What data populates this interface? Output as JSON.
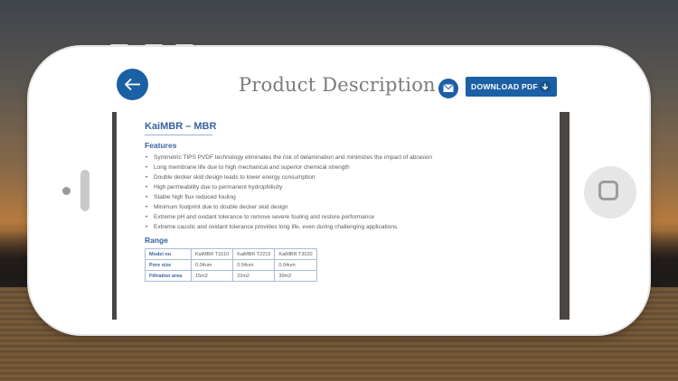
{
  "header": {
    "title": "Product Description",
    "download_label": "DOWNLOAD PDF"
  },
  "doc": {
    "title": "KaiMBR – MBR",
    "features_heading": "Features",
    "features": [
      "Symmetric TIPS PVDF technology eliminates the risk of delamination and minimizes the impact of abrasion",
      "Long membrane life due to high mechanical and superior chemical strength",
      "Double decker skid design leads to lower energy consumption",
      "High permeability due to permanent hydrophilicity",
      "Stable high flux reduced fouling",
      "Minimum footprint due to double decker skid design",
      "Extreme pH and oxidant tolerance to remove severe fouling and restore performance",
      "Extreme caustic and oxidant tolerance provides long life, even during challenging applications."
    ],
    "range_heading": "Range",
    "table": {
      "rows": [
        [
          "Model no",
          "KaiMBR T1510",
          "KaiMBR T2215",
          "KaiMBR T3020"
        ],
        [
          "Pore size",
          "0.04um",
          "0.04um",
          "0.04um"
        ],
        [
          "Filtration area",
          "15m2",
          "22m2",
          "30m2"
        ]
      ]
    }
  },
  "colors": {
    "accent": "#1b5fa5",
    "heading": "#3a63a0"
  },
  "icons": {
    "back": "arrow-left-icon",
    "mail": "envelope-icon",
    "download": "download-arrow-icon"
  }
}
